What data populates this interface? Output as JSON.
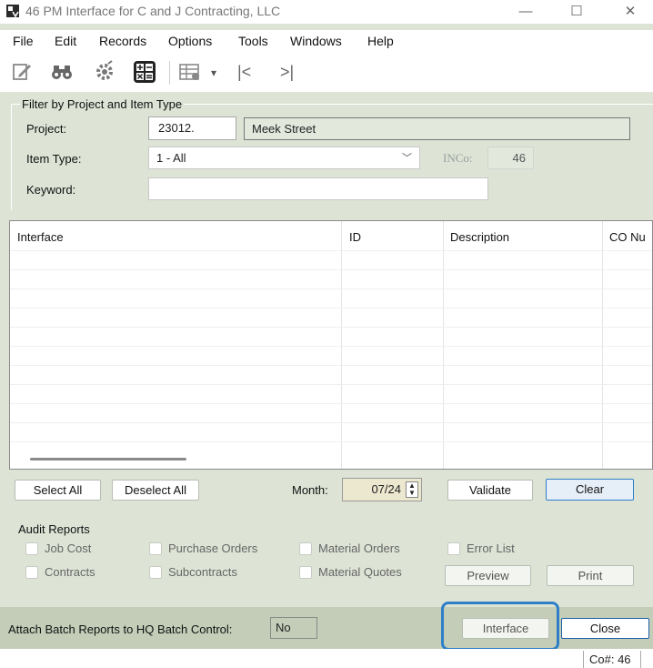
{
  "window": {
    "title": "46 PM Interface for C and J Contracting, LLC",
    "minimize": "—",
    "maximize": "☐",
    "close": "✕"
  },
  "menu": [
    "File",
    "Edit",
    "Records",
    "Options",
    "Tools",
    "Windows",
    "Help"
  ],
  "toolbar": {
    "dropdown_arrow": "▾",
    "first_record": "|<",
    "last_record": ">|"
  },
  "filter": {
    "group_label": "Filter by Project and Item Type",
    "project_label": "Project:",
    "project_value": "23012.",
    "project_name": "Meek Street",
    "item_type_label": "Item Type:",
    "item_type_value": "1 - All",
    "inco_label": "INCo:",
    "inco_value": "46",
    "keyword_label": "Keyword:",
    "keyword_value": ""
  },
  "grid": {
    "columns": [
      "Interface",
      "ID",
      "Description",
      "CO Nu"
    ]
  },
  "actions": {
    "select_all": "Select All",
    "deselect_all": "Deselect All",
    "month_label": "Month:",
    "month_value": "07/24",
    "validate": "Validate",
    "clear": "Clear"
  },
  "audit": {
    "group_label": "Audit Reports",
    "checkboxes": [
      "Job Cost",
      "Purchase Orders",
      "Material Orders",
      "Error List",
      "Contracts",
      "Subcontracts",
      "Material Quotes"
    ],
    "preview": "Preview",
    "print": "Print"
  },
  "bottom": {
    "attach_label": "Attach Batch Reports to HQ Batch Control:",
    "attach_value": "No",
    "interface": "Interface",
    "close": "Close"
  },
  "status": {
    "company": "Co#: 46"
  },
  "colors": {
    "highlight": "#2f7fc8",
    "panel": "#dde3d5",
    "bottom_panel": "#c3cdb8"
  }
}
